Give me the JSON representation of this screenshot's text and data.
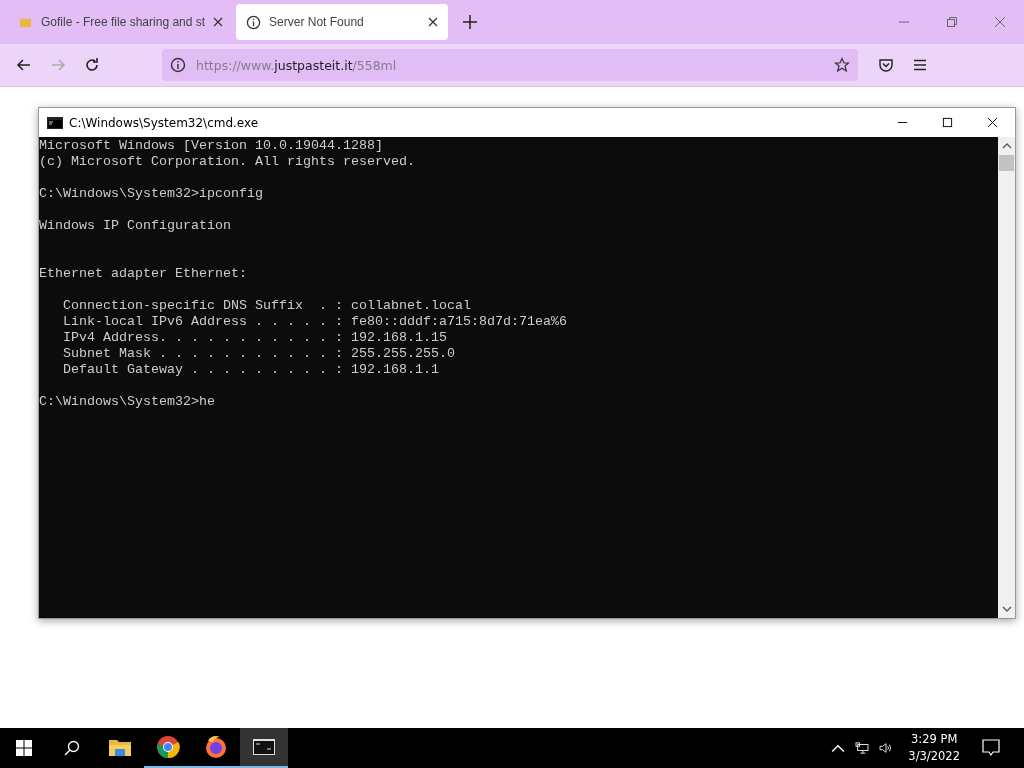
{
  "browser": {
    "tabs": [
      {
        "title": "Gofile - Free file sharing and st",
        "selected": false
      },
      {
        "title": "Server Not Found",
        "selected": true
      }
    ],
    "address": {
      "prefix": "https://www.",
      "domain": "justpasteit.it",
      "path": "/558ml"
    }
  },
  "console": {
    "title": "C:\\Windows\\System32\\cmd.exe",
    "blocks": [
      {
        "kind": "text",
        "lines": [
          "Microsoft Windows [Version 10.0.19044.1288]",
          "(c) Microsoft Corporation. All rights reserved."
        ]
      },
      {
        "kind": "text",
        "lines": [
          "C:\\Windows\\System32>ipconfig"
        ]
      },
      {
        "kind": "text",
        "lines": [
          "Windows IP Configuration"
        ]
      },
      {
        "kind": "section",
        "lines": [
          "Ethernet adapter Ethernet:"
        ]
      },
      {
        "kind": "text",
        "lines": [
          "   Connection-specific DNS Suffix  . : collabnet.local",
          "   Link-local IPv6 Address . . . . . : fe80::dddf:a715:8d7d:71ea%6",
          "   IPv4 Address. . . . . . . . . . . : 192.168.1.15",
          "   Subnet Mask . . . . . . . . . . . : 255.255.255.0",
          "   Default Gateway . . . . . . . . . : 192.168.1.1"
        ]
      },
      {
        "kind": "text",
        "lines": [
          "C:\\Windows\\System32>he"
        ]
      }
    ]
  },
  "taskbar": {
    "apps": [
      {
        "kind": "folder",
        "running": false,
        "active": false
      },
      {
        "kind": "chrome",
        "running": true,
        "active": false
      },
      {
        "kind": "firefox",
        "running": true,
        "active": false
      },
      {
        "kind": "console",
        "running": true,
        "active": true
      }
    ],
    "time": "3:29 PM",
    "date": "3/3/2022"
  }
}
